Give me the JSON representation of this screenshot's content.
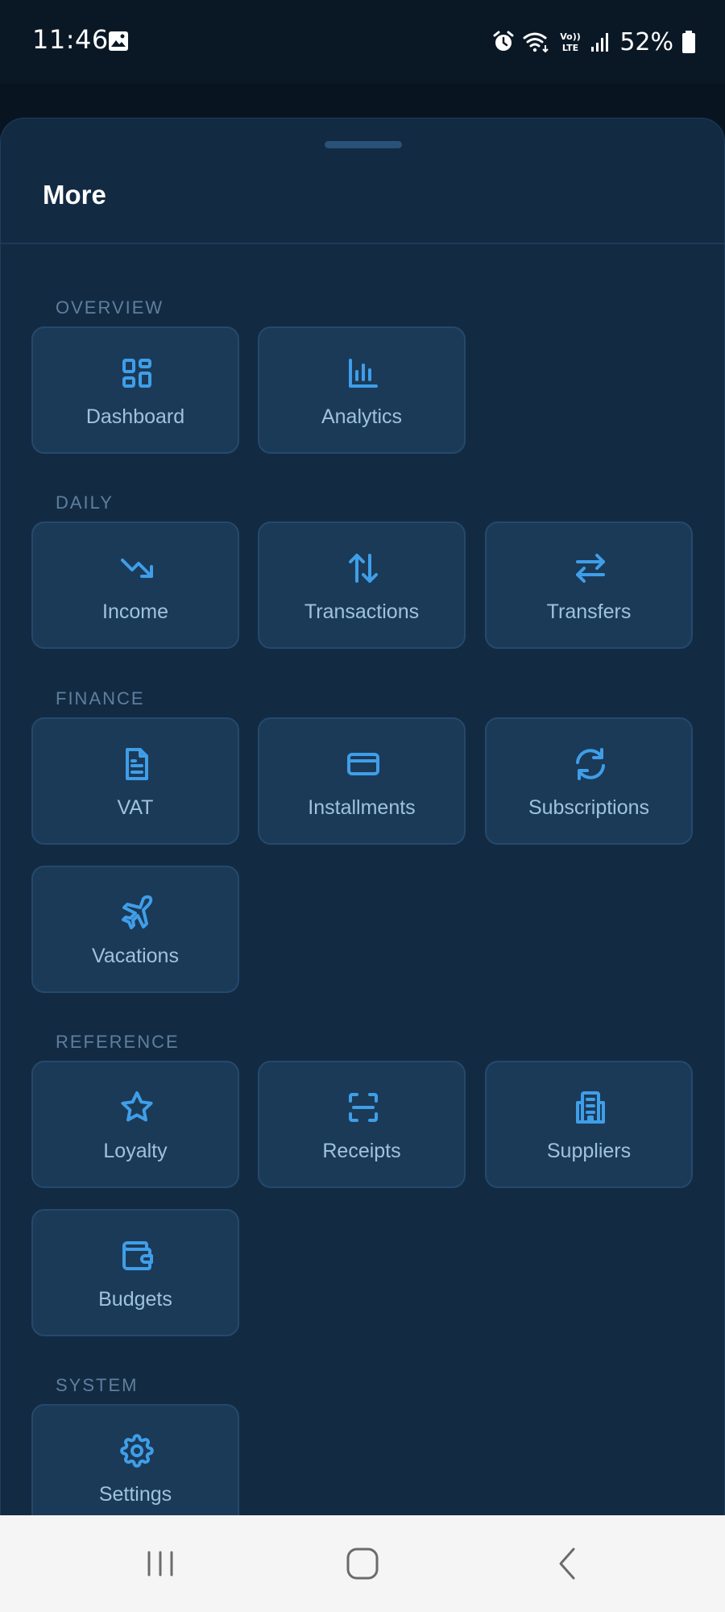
{
  "status_bar": {
    "time": "11:46",
    "battery": "52%",
    "icons": [
      "gallery-icon",
      "alarm-icon",
      "wifi-icon",
      "volte-icon",
      "signal-icon",
      "battery-icon"
    ]
  },
  "sheet": {
    "title": "More"
  },
  "sections": {
    "overview": {
      "label": "OVERVIEW",
      "items": [
        {
          "label": "Dashboard",
          "icon": "dashboard-icon"
        },
        {
          "label": "Analytics",
          "icon": "bar-chart-icon"
        }
      ]
    },
    "daily": {
      "label": "DAILY",
      "items": [
        {
          "label": "Income",
          "icon": "trending-down-icon"
        },
        {
          "label": "Transactions",
          "icon": "arrows-up-down-icon"
        },
        {
          "label": "Transfers",
          "icon": "arrows-left-right-icon"
        }
      ]
    },
    "finance": {
      "label": "FINANCE",
      "items": [
        {
          "label": "VAT",
          "icon": "document-icon"
        },
        {
          "label": "Installments",
          "icon": "credit-card-icon"
        },
        {
          "label": "Subscriptions",
          "icon": "refresh-icon"
        },
        {
          "label": "Vacations",
          "icon": "plane-icon"
        }
      ]
    },
    "reference": {
      "label": "REFERENCE",
      "items": [
        {
          "label": "Loyalty",
          "icon": "star-icon"
        },
        {
          "label": "Receipts",
          "icon": "scan-icon"
        },
        {
          "label": "Suppliers",
          "icon": "building-icon"
        },
        {
          "label": "Budgets",
          "icon": "wallet-icon"
        }
      ]
    },
    "system": {
      "label": "SYSTEM",
      "items": [
        {
          "label": "Settings",
          "icon": "gear-icon"
        }
      ]
    }
  },
  "colors": {
    "sheet_bg": "#132a43",
    "tile_bg": "#1b3a58",
    "icon_accent": "#3f9ee8",
    "tile_label": "#9fc2e0",
    "section_label": "#5e7f9e"
  },
  "nav_bar": {
    "buttons": [
      "recent-apps-icon",
      "home-icon",
      "back-icon"
    ]
  }
}
